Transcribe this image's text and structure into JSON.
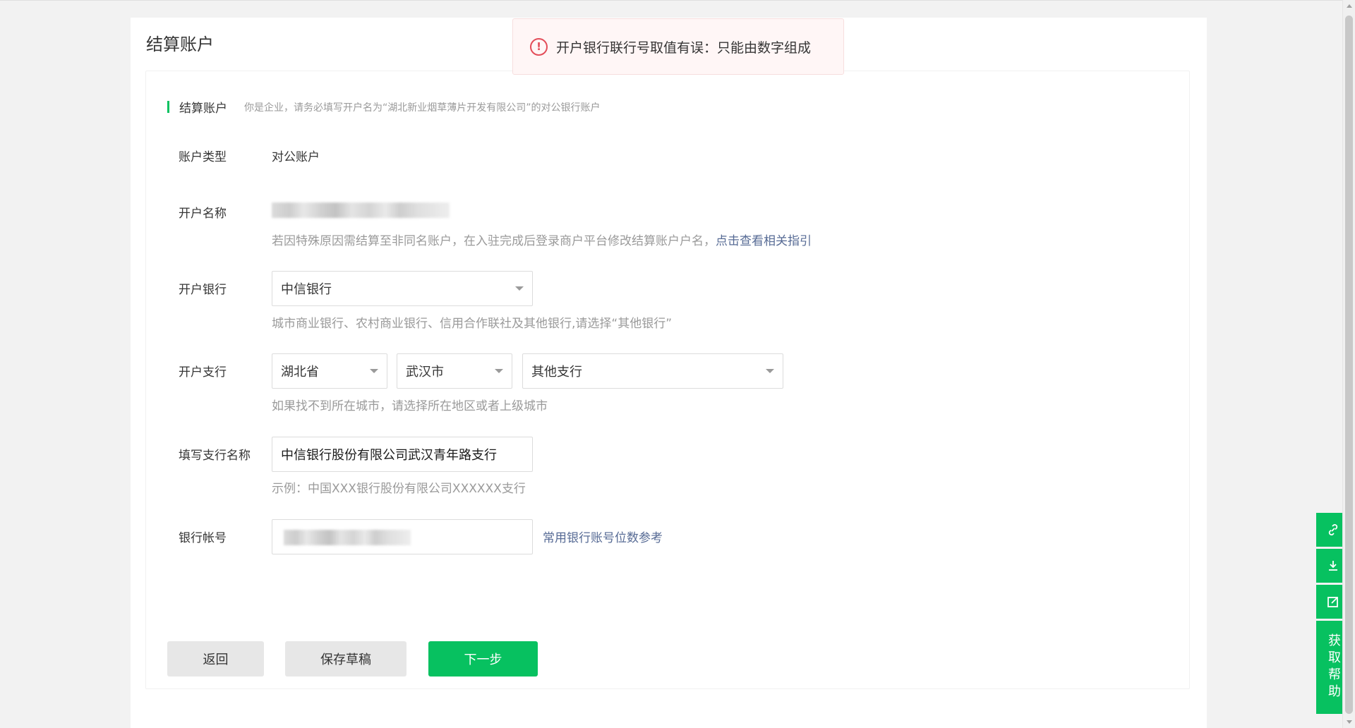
{
  "page": {
    "title": "结算账户"
  },
  "section": {
    "title": "结算账户",
    "tip": "你是企业，请务必填写开户名为“湖北新业烟草薄片开发有限公司”的对公银行账户"
  },
  "account_type": {
    "label": "账户类型",
    "value": "对公账户"
  },
  "account_name": {
    "label": "开户名称",
    "hint": "若因特殊原因需结算至非同名账户，在入驻完成后登录商户平台修改结算账户户名，",
    "hint_link": "点击查看相关指引"
  },
  "bank": {
    "label": "开户银行",
    "selected": "中信银行",
    "hint": "城市商业银行、农村商业银行、信用合作联社及其他银行,请选择“其他银行”"
  },
  "branch": {
    "label": "开户支行",
    "province": "湖北省",
    "city": "武汉市",
    "branch": "其他支行",
    "hint": "如果找不到所在城市，请选择所在地区或者上级城市"
  },
  "branch_name": {
    "label": "填写支行名称",
    "value": "中信银行股份有限公司武汉青年路支行",
    "hint": "示例：中国XXX银行股份有限公司XXXXXX支行"
  },
  "bank_account": {
    "label": "银行帐号",
    "ref_link": "常用银行账号位数参考"
  },
  "buttons": {
    "back": "返回",
    "save_draft": "保存草稿",
    "next": "下一步"
  },
  "toast": {
    "icon": "error-circle-icon",
    "message": "开户银行联行号取值有误：只能由数字组成"
  },
  "side_tools": {
    "help": "获取帮助"
  },
  "colors": {
    "accent": "#07c160",
    "link": "#576b95",
    "error": "#e34d59"
  }
}
